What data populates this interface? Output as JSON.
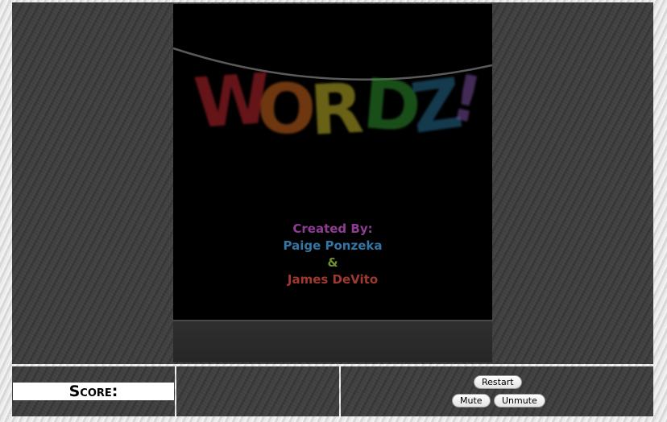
{
  "game": {
    "logo_letters": [
      "W",
      "O",
      "R",
      "D",
      "Z",
      "!"
    ],
    "logo_colors": [
      "#b8262d",
      "#c8651e",
      "#bfb229",
      "#2f8f2f",
      "#256a8f",
      "#7b4f9e"
    ],
    "credits": {
      "heading": "Created By:",
      "author1": "Paige Ponzeka",
      "ampersand": "&",
      "author2": "James DeVito"
    },
    "credit_colors": {
      "heading": "#b04ab5",
      "author1": "#3f8fc8",
      "ampersand": "#8cb33a",
      "author2": "#c2453a"
    }
  },
  "hud": {
    "score_label": "Score:",
    "restart_label": "Restart",
    "mute_label": "Mute",
    "unmute_label": "Unmute"
  }
}
